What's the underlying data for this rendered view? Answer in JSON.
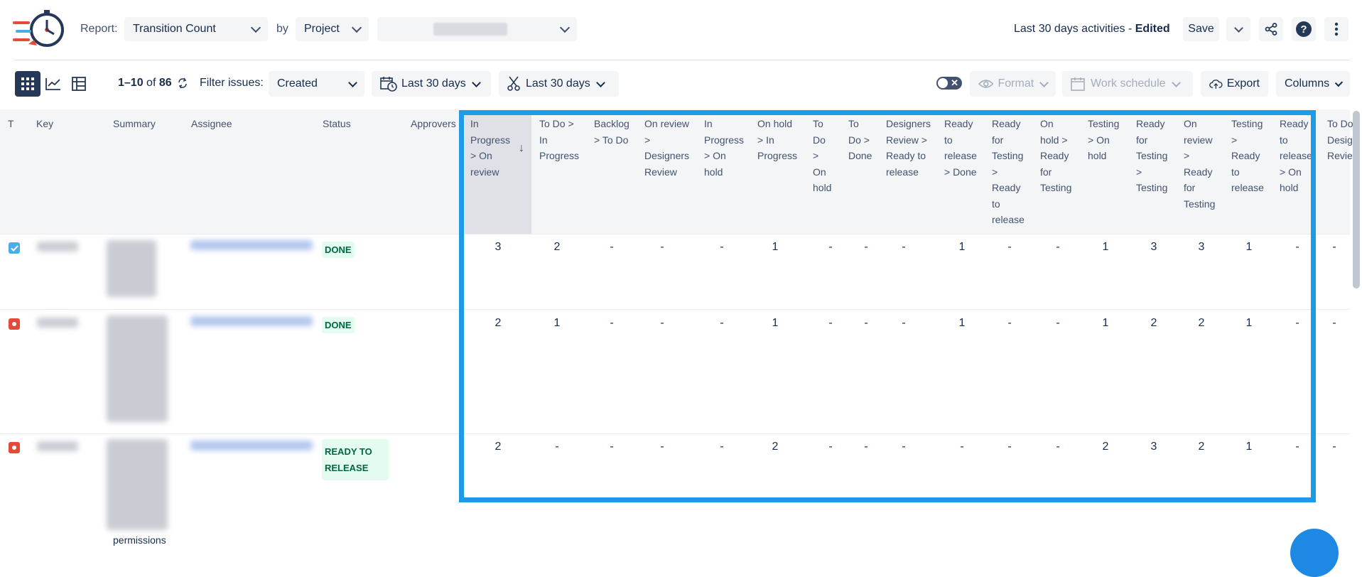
{
  "header": {
    "report_label": "Report:",
    "report_value": "Transition Count",
    "by_label": "by",
    "by_value": "Project",
    "title_prefix": "Last 30 days activities - ",
    "title_suffix": "Edited",
    "save_label": "Save"
  },
  "toolbar": {
    "pagination_range": "1–10",
    "pagination_of": "of",
    "pagination_total": "86",
    "filter_label": "Filter issues:",
    "filter_value": "Created",
    "date1": "Last 30 days",
    "date2": "Last 30 days",
    "format_label": "Format",
    "work_schedule_label": "Work schedule",
    "export_label": "Export",
    "columns_label": "Columns"
  },
  "table": {
    "fixed_headers": [
      "T",
      "Key",
      "Summary",
      "Assignee",
      "Status",
      "Approvers"
    ],
    "transition_headers": [
      [
        "In",
        "Progress",
        "> On",
        "review"
      ],
      [
        "To Do >",
        "In",
        "Progress"
      ],
      [
        "Backlog",
        "> To Do"
      ],
      [
        "On review",
        ">",
        "Designers",
        "Review"
      ],
      [
        "In",
        "Progress",
        "> On",
        "hold"
      ],
      [
        "On hold",
        "> In",
        "Progress"
      ],
      [
        "To",
        "Do",
        ">",
        "On",
        "hold"
      ],
      [
        "To",
        "Do >",
        "Done"
      ],
      [
        "Designers",
        "Review >",
        "Ready to",
        "release"
      ],
      [
        "Ready",
        "to",
        "release",
        "> Done"
      ],
      [
        "Ready",
        "for",
        "Testing",
        ">",
        "Ready",
        "to",
        "release"
      ],
      [
        "On",
        "hold >",
        "Ready",
        "for",
        "Testing"
      ],
      [
        "Testing",
        "> On",
        "hold"
      ],
      [
        "Ready",
        "for",
        "Testing",
        ">",
        "Testing"
      ],
      [
        "On",
        "review",
        ">",
        "Ready",
        "for",
        "Testing"
      ],
      [
        "Testing",
        ">",
        "Ready",
        "to",
        "release"
      ],
      [
        "Ready",
        "to",
        "release",
        "> On",
        "hold"
      ],
      [
        "To Do",
        "Desig",
        "Revie"
      ]
    ],
    "rows": [
      {
        "type": "task",
        "status": "DONE",
        "values": [
          "3",
          "2",
          "-",
          "-",
          "-",
          "1",
          "-",
          "-",
          "-",
          "1",
          "-",
          "-",
          "1",
          "3",
          "3",
          "1",
          "-",
          "-"
        ]
      },
      {
        "type": "bug",
        "status": "DONE",
        "values": [
          "2",
          "1",
          "-",
          "-",
          "-",
          "1",
          "-",
          "-",
          "-",
          "1",
          "-",
          "-",
          "1",
          "2",
          "2",
          "1",
          "-",
          "-"
        ]
      },
      {
        "type": "bug",
        "status": "READY TO RELEASE",
        "values": [
          "2",
          "-",
          "-",
          "-",
          "-",
          "2",
          "-",
          "-",
          "-",
          "-",
          "-",
          "-",
          "2",
          "3",
          "2",
          "1",
          "-",
          "-"
        ]
      }
    ],
    "partial_text": "permissions"
  },
  "colors": {
    "highlight": "#1e9be6",
    "done_text": "#006644",
    "done_bg": "#e3fcef",
    "task_icon": "#4bade8",
    "bug_icon": "#e5493a",
    "active_view": "#253858"
  },
  "icons": {
    "logo": "stopwatch-rocket-logo",
    "share": "share-icon",
    "help": "help-icon",
    "more": "more-vertical-icon",
    "refresh": "refresh-icon",
    "calendar": "calendar-clock-icon",
    "scissors": "scissors-icon",
    "eye": "eye-icon",
    "cloud": "cloud-upload-icon"
  }
}
